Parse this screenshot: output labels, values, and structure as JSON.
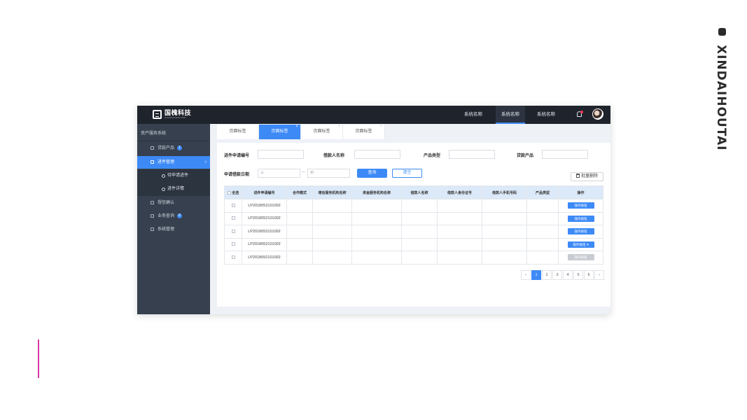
{
  "brand": {
    "vertical_text": "XINDAIHOUTAI"
  },
  "header": {
    "logo_cn": "国槐科技",
    "logo_en": "GUOHUAITECH.COM",
    "nav": [
      "系统名称",
      "系统名称",
      "系统名称"
    ],
    "active_nav_index": 1
  },
  "sidebar": {
    "title": "资产服务系统",
    "items": [
      {
        "label": "贷款产品",
        "badge": "1"
      },
      {
        "label": "进件管理"
      },
      {
        "label": "待申请进件"
      },
      {
        "label": "进件详情"
      },
      {
        "label": "授信确认"
      },
      {
        "label": "业务查询",
        "badge": "6"
      },
      {
        "label": "系统管理"
      }
    ]
  },
  "tabs": [
    "页面标签",
    "页面标签",
    "页面标签",
    "页面标签"
  ],
  "active_tab_index": 1,
  "filters": {
    "app_no_label": "进件申请编号",
    "borrower_label": "借款人名称",
    "product_type_label": "产品类型",
    "loan_product_label": "贷款产品",
    "date_label": "申请借款日期",
    "date_from_placeholder": "从",
    "date_sep": "—",
    "date_to_placeholder": "到",
    "query_btn": "查询",
    "clear_btn": "清空",
    "batch_delete_btn": "批量删除"
  },
  "table": {
    "columns": [
      "全选",
      "进件申请编号",
      "合作模式",
      "增信服务机构名称",
      "资金服务机构名称",
      "借款人名称",
      "借款人身份证号",
      "借款人手机号码",
      "产品类型",
      "操作"
    ],
    "rows": [
      {
        "app_no": "LP2018052101002",
        "op": "操作按钮"
      },
      {
        "app_no": "LP2018052101002",
        "op": "操作按钮"
      },
      {
        "app_no": "LP2018052101002",
        "op": "操作按钮"
      },
      {
        "app_no": "LP2018052101002",
        "op": "操作按钮"
      },
      {
        "app_no": "LP2018052101002",
        "op": "操作按钮"
      }
    ]
  },
  "pagination": {
    "prev": "‹",
    "pages": [
      "1",
      "2",
      "3",
      "4",
      "5",
      "6"
    ],
    "next": "›",
    "current": "1"
  },
  "colors": {
    "accent": "#3d8af7",
    "topbar": "#1f232c",
    "sidebar": "#36404e",
    "pink_line": "#d63aa6"
  }
}
